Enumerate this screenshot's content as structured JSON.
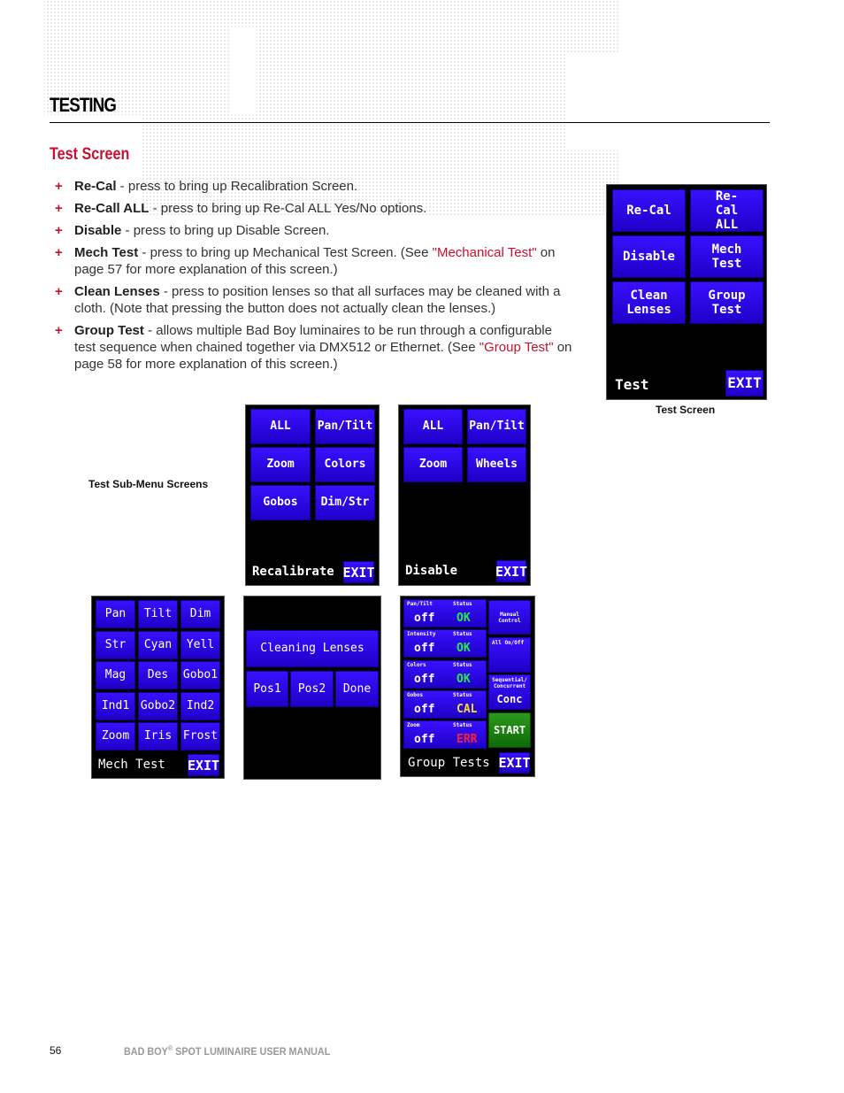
{
  "page": {
    "section_title": "TESTING",
    "subsection_title": "Test Screen",
    "bullets": [
      {
        "term": "Re-Cal",
        "text": " - press to bring up Recalibration Screen."
      },
      {
        "term": "Re-Call ALL",
        "text": " - press to bring up Re-Cal ALL Yes/No options."
      },
      {
        "term": "Disable",
        "text": " - press to bring up Disable Screen."
      },
      {
        "term": "Mech Test",
        "text": " - press to bring up Mechanical Test Screen. (See ",
        "link": "\"Mechanical Test\"",
        "text_after": " on page 57 for more explanation of this screen.)"
      },
      {
        "term": "Clean Lenses",
        "text": " - press to position lenses so that all surfaces may be cleaned with a cloth. (Note that pressing the button does not actually clean the lenses.)"
      },
      {
        "term": "Group Test",
        "text": " - allows multiple Bad Boy luminaires to be run through a configurable test sequence when chained together via DMX512 or Ethernet. (See ",
        "link": "\"Group Test\"",
        "text_after": " on page 58 for more explanation of this screen.)"
      }
    ],
    "bullet_marker": "+"
  },
  "test_screen": {
    "buttons": [
      "Re-Cal",
      "Re-Cal ALL",
      "Disable",
      "Mech Test",
      "Clean Lenses",
      "Group Test"
    ],
    "label": "Test",
    "exit": "EXIT",
    "caption": "Test Screen"
  },
  "submenu_caption": "Test Sub-Menu Screens",
  "recalibrate_screen": {
    "buttons": [
      "ALL",
      "Pan/Tilt",
      "Zoom",
      "Colors",
      "Gobos",
      "Dim/Str"
    ],
    "label": "Recalibrate",
    "exit": "EXIT"
  },
  "disable_screen": {
    "buttons": [
      "ALL",
      "Pan/Tilt",
      "Zoom",
      "Wheels"
    ],
    "label": "Disable",
    "exit": "EXIT"
  },
  "mech_test_screen": {
    "buttons": [
      "Pan",
      "Tilt",
      "Dim",
      "Str",
      "Cyan",
      "Yell",
      "Mag",
      "Des",
      "Gobo1",
      "Ind1",
      "Gobo2",
      "Ind2",
      "Zoom",
      "Iris",
      "Frost"
    ],
    "label": "Mech Test",
    "exit": "EXIT"
  },
  "cleaning_screen": {
    "header": "Cleaning Lenses",
    "buttons": [
      "Pos1",
      "Pos2",
      "Done"
    ]
  },
  "group_tests_screen": {
    "rows": [
      {
        "name": "Pan/Tilt",
        "status_label": "Status",
        "value": "off",
        "status": "OK",
        "status_color": "#22ee44"
      },
      {
        "name": "Intensity",
        "status_label": "Status",
        "value": "off",
        "status": "OK",
        "status_color": "#22ee44"
      },
      {
        "name": "Colors",
        "status_label": "Status",
        "value": "off",
        "status": "OK",
        "status_color": "#22ee44"
      },
      {
        "name": "Gobos",
        "status_label": "Status",
        "value": "off",
        "status": "CAL",
        "status_color": "#f0e020"
      },
      {
        "name": "Zoom",
        "status_label": "Status",
        "value": "off",
        "status": "ERR",
        "status_color": "#ff2030"
      }
    ],
    "side": {
      "manual_control": "Manual Control",
      "all_on_off": "All On/Off",
      "seq_conc_label": "Sequential/ Concurrent",
      "seq_conc_value": "Conc",
      "start": "START"
    },
    "label": "Group Tests",
    "exit": "EXIT"
  },
  "footer": {
    "page_number": "56",
    "manual_title": "BAD BOY",
    "registered": "®",
    "manual_title_rest": " SPOT LUMINAIRE USER MANUAL"
  },
  "colors": {
    "accent_red": "#c8102e",
    "button_blue": "#2a08f0",
    "start_green": "#1a8a10"
  }
}
